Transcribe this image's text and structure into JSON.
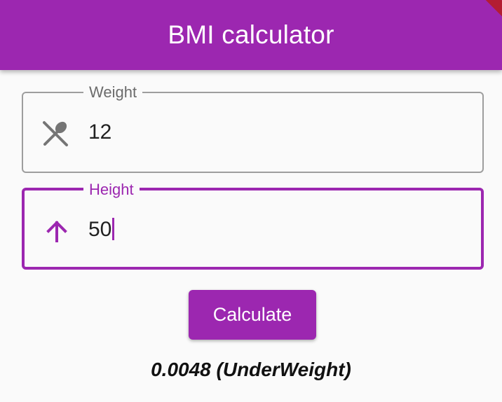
{
  "appbar": {
    "title": "BMI calculator",
    "color": "#9c27b0"
  },
  "weight_field": {
    "label": "Weight",
    "value": "12",
    "icon": "restaurant-icon"
  },
  "height_field": {
    "label": "Height",
    "value": "50",
    "icon": "arrow-upward-icon",
    "focused": true
  },
  "calculate_button": {
    "label": "Calculate"
  },
  "result": {
    "text": "0.0048 (UnderWeight)"
  }
}
